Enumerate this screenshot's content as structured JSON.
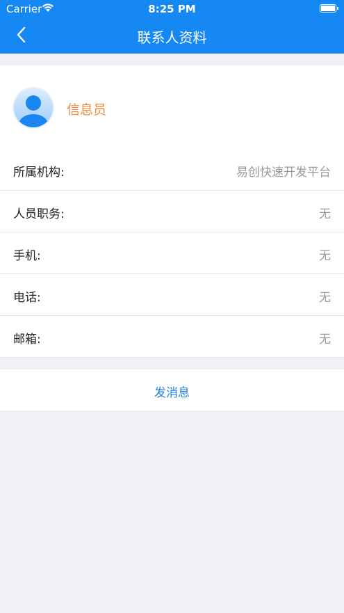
{
  "status_bar": {
    "carrier": "Carrier",
    "time": "8:25 PM"
  },
  "nav": {
    "title": "联系人资料",
    "back_icon": "chevron-left-icon"
  },
  "profile": {
    "name": "信息员",
    "avatar_icon": "person-avatar-icon"
  },
  "fields": [
    {
      "label": "所属机构:",
      "value": "易创快速开发平台"
    },
    {
      "label": "人员职务:",
      "value": "无"
    },
    {
      "label": "手机:",
      "value": "无"
    },
    {
      "label": "电话:",
      "value": "无"
    },
    {
      "label": "邮箱:",
      "value": "无"
    }
  ],
  "action": {
    "send_message_label": "发消息"
  },
  "colors": {
    "header": "#1588f3",
    "name": "#f08a3a",
    "action": "#1f7fe0",
    "background": "#f0f0f5"
  }
}
